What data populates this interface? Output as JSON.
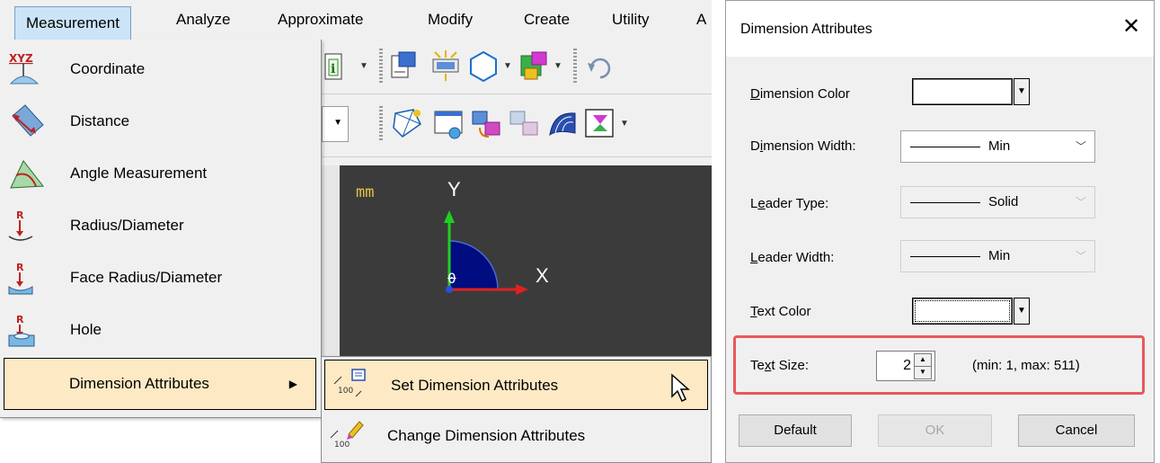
{
  "menubar": {
    "items": [
      "Measurement",
      "Analyze",
      "Approximate",
      "Modify",
      "Create",
      "Utility",
      "A"
    ]
  },
  "measurement_menu": {
    "items": [
      {
        "label": "Coordinate",
        "icon": "xyz-coordinate-icon"
      },
      {
        "label": "Distance",
        "icon": "distance-icon"
      },
      {
        "label": "Angle Measurement",
        "icon": "angle-icon"
      },
      {
        "label": "Radius/Diameter",
        "icon": "radius-icon"
      },
      {
        "label": "Face Radius/Diameter",
        "icon": "face-radius-icon"
      },
      {
        "label": "Hole",
        "icon": "hole-icon"
      },
      {
        "label": "Dimension Attributes",
        "icon": "",
        "has_submenu": true
      }
    ]
  },
  "submenu": {
    "items": [
      {
        "label": "Set Dimension Attributes",
        "highlighted": true
      },
      {
        "label": "Change Dimension Attributes",
        "highlighted": false
      }
    ]
  },
  "viewport": {
    "unit": "mm",
    "axis_y": "Y",
    "axis_x": "X",
    "origin_label": "0"
  },
  "icons": {
    "menu_dd_icons": [
      "xyz-coordinate-icon",
      "distance-icon",
      "angle-icon",
      "radius-icon",
      "face-radius-icon",
      "hole-icon"
    ],
    "toolbar_row1": [
      "info-icon",
      "document-icon",
      "scan-icon",
      "hexagon-icon",
      "color-shape-icon",
      "undo-icon"
    ],
    "toolbar_row2": [
      "wireframe-icon",
      "window-icon",
      "transform-icon",
      "copy-shapes-icon",
      "mesh-icon",
      "fit-icon"
    ]
  },
  "dialog": {
    "title": "Dimension Attributes",
    "close_glyph": "✕",
    "dimension_color_label": {
      "pre": "",
      "u": "D",
      "post": "imension Color"
    },
    "dimension_width_label": {
      "pre": "D",
      "u": "i",
      "post": "mension Width:"
    },
    "leader_type_label": {
      "pre": "L",
      "u": "e",
      "post": "ader Type:"
    },
    "leader_width_label": {
      "pre": "",
      "u": "L",
      "post": "eader Width:"
    },
    "text_color_label": {
      "pre": "",
      "u": "T",
      "post": "ext Color"
    },
    "text_size_label": {
      "pre": "Te",
      "u": "x",
      "post": "t Size:"
    },
    "dimension_width_value": "Min",
    "leader_type_value": "Solid",
    "leader_width_value": "Min",
    "text_size_value": "2",
    "text_size_range": "(min: 1, max: 511)",
    "buttons": {
      "default": "Default",
      "ok": "OK",
      "cancel": "Cancel"
    },
    "highlight_color": "#e8585a"
  }
}
